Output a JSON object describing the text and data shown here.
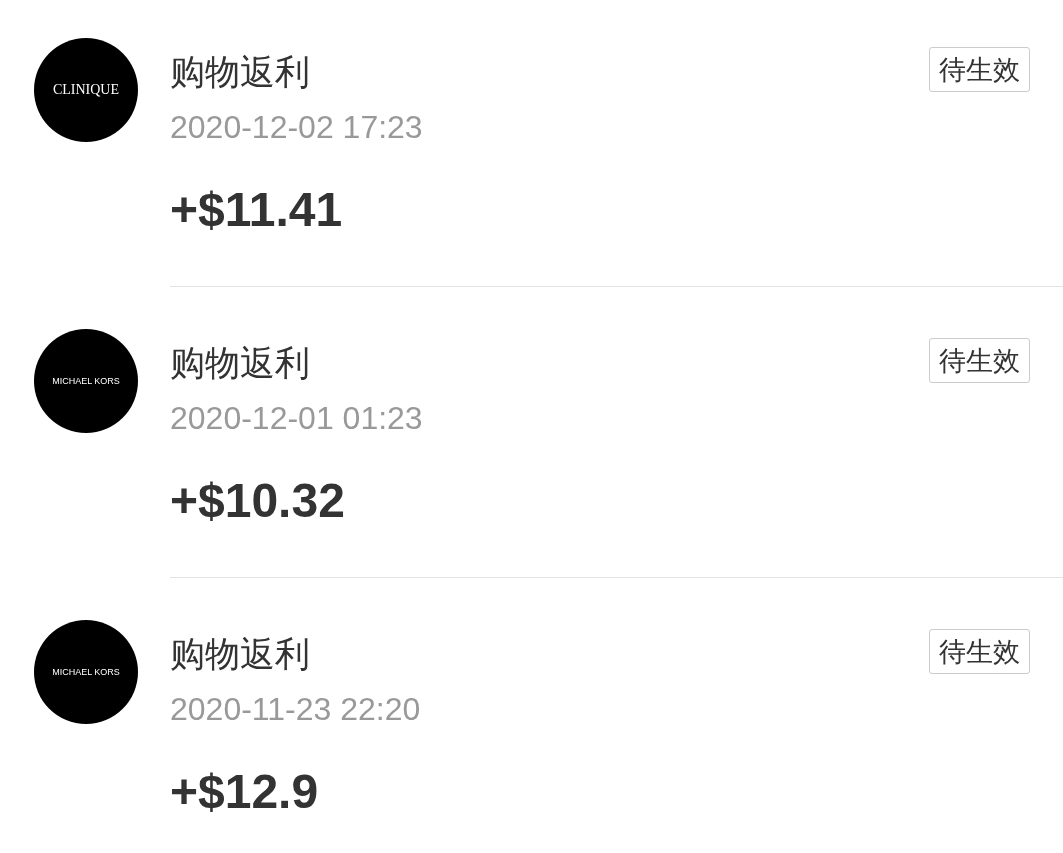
{
  "records": [
    {
      "logo": "CLINIQUE",
      "title": "购物返利",
      "time": "2020-12-02 17:23",
      "amount": "+$11.41",
      "status": "待生效"
    },
    {
      "logo": "MICHAEL KORS",
      "title": "购物返利",
      "time": "2020-12-01 01:23",
      "amount": "+$10.32",
      "status": "待生效"
    },
    {
      "logo": "MICHAEL KORS",
      "title": "购物返利",
      "time": "2020-11-23 22:20",
      "amount": "+$12.9",
      "status": "待生效"
    }
  ]
}
